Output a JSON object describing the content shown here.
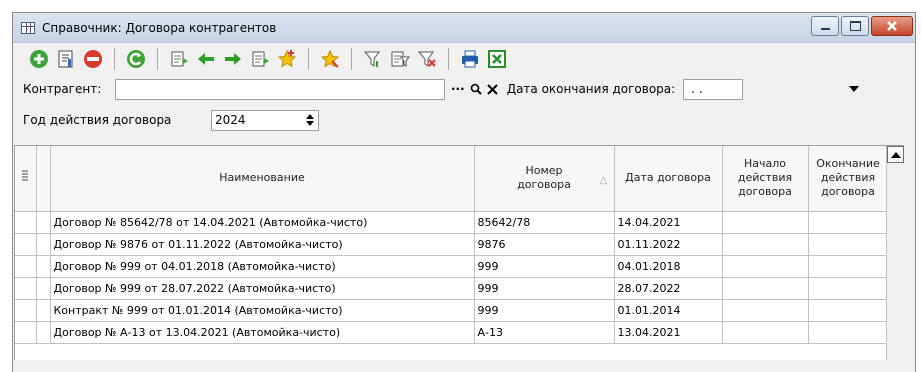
{
  "window": {
    "title": "Справочник: Договора контрагентов"
  },
  "toolbar": [
    {
      "name": "add-icon",
      "color": "#3fa33a"
    },
    {
      "name": "edit-icon",
      "color": "#4a4a4a"
    },
    {
      "name": "delete-icon",
      "color": "#d83a2c"
    },
    {
      "name": "refresh-icon",
      "color": "#3fa33a"
    },
    {
      "name": "copy-doc-icon",
      "color": "#6a6a6a"
    },
    {
      "name": "arrow-left-icon",
      "color": "#2e9e2a"
    },
    {
      "name": "arrow-right-icon",
      "color": "#2e9e2a"
    },
    {
      "name": "paste-doc-icon",
      "color": "#6a6a6a"
    },
    {
      "name": "add-favorite-icon",
      "color": "#e8b000"
    },
    {
      "name": "favorites-icon",
      "color": "#e8b000"
    },
    {
      "name": "filter-icon",
      "color": "#555555"
    },
    {
      "name": "filter-set-icon",
      "color": "#555555"
    },
    {
      "name": "filter-clear-icon",
      "color": "#d83a2c"
    },
    {
      "name": "print-icon",
      "color": "#1f5fa8"
    },
    {
      "name": "excel-export-icon",
      "color": "#2e8b2e"
    }
  ],
  "filters": {
    "contractor_label": "Контрагент:",
    "contractor_value": "",
    "contractor_dots": "···",
    "end_date_label": "Дата окончания договора:",
    "end_date_value": ". .",
    "year_label": "Год действия договора",
    "year_value": "2024"
  },
  "table": {
    "headers": {
      "name": "Наименование",
      "number": "Номер договора",
      "date": "Дата договора",
      "start": "Начало действия договора",
      "end": "Окончание действия договора"
    },
    "rows": [
      {
        "name": "Договор № 85642/78 от 14.04.2021 (Автомойка-чисто)",
        "number": "85642/78",
        "date": "14.04.2021",
        "start": "",
        "end": ""
      },
      {
        "name": "Договор № 9876 от 01.11.2022 (Автомойка-чисто)",
        "number": "9876",
        "date": "01.11.2022",
        "start": "",
        "end": ""
      },
      {
        "name": "Договор № 999 от 04.01.2018 (Автомойка-чисто)",
        "number": "999",
        "date": "04.01.2018",
        "start": "",
        "end": ""
      },
      {
        "name": "Договор № 999 от 28.07.2022 (Автомойка-чисто)",
        "number": "999",
        "date": "28.07.2022",
        "start": "",
        "end": ""
      },
      {
        "name": "Контракт № 999  от 01.01.2014 (Автомойка-чисто)",
        "number": "999",
        "date": "01.01.2014",
        "start": "",
        "end": ""
      },
      {
        "name": "Договор № А-13 от 13.04.2021 (Автомойка-чисто)",
        "number": "А-13",
        "date": "13.04.2021",
        "start": "",
        "end": ""
      }
    ]
  }
}
